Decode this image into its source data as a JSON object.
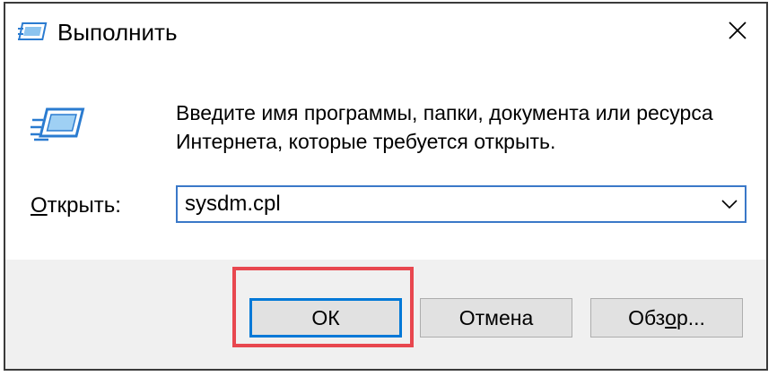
{
  "window": {
    "title": "Выполнить",
    "title_icon": "run-dialog-icon",
    "close_icon": "close-icon"
  },
  "content": {
    "description_line1": "Введите имя программы, папки, документа или ресурса",
    "description_line2": "Интернета, которые требуется открыть.",
    "open_label_prefix": "О",
    "open_label_rest": "ткрыть:",
    "input_value": "sysdm.cpl",
    "dropdown_icon": "chevron-down-icon"
  },
  "buttons": {
    "ok_label": "ОК",
    "cancel_label": "Отмена",
    "browse_label_pre": "Обз",
    "browse_label_u": "о",
    "browse_label_post": "р..."
  },
  "colors": {
    "focus_blue": "#0078d7",
    "highlight_red": "#e8474f",
    "dialog_bg": "#f0f0f0"
  }
}
